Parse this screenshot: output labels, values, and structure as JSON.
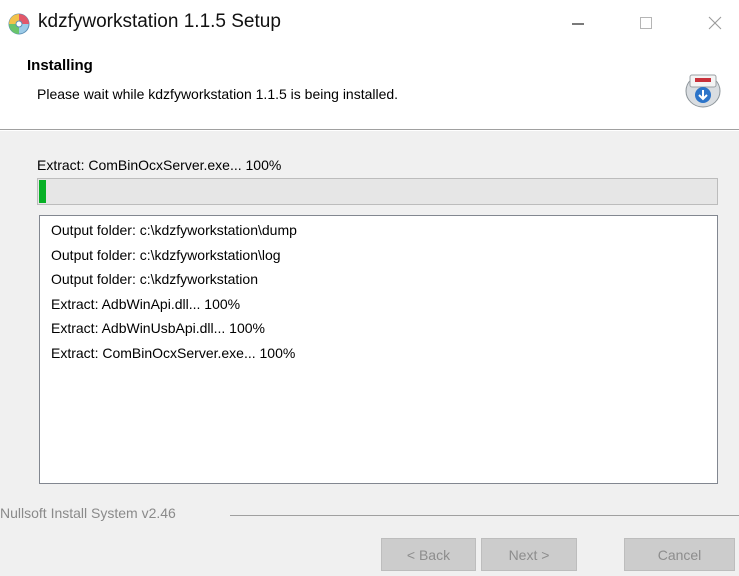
{
  "window": {
    "title": "kdzfyworkstation 1.1.5 Setup",
    "icon": "installer-disc-icon"
  },
  "header": {
    "title": "Installing",
    "subtitle": "Please wait while kdzfyworkstation 1.1.5 is being installed.",
    "icon": "installer-box-icon"
  },
  "status": {
    "text": "Extract: ComBinOcxServer.exe... 100%",
    "progress_percent": 1
  },
  "log": {
    "items": [
      "Output folder: c:\\kdzfyworkstation\\dump",
      "Output folder: c:\\kdzfyworkstation\\log",
      "Output folder: c:\\kdzfyworkstation",
      "Extract: AdbWinApi.dll... 100%",
      "Extract: AdbWinUsbApi.dll... 100%",
      "Extract: ComBinOcxServer.exe... 100%"
    ]
  },
  "footer": {
    "brand": "Nullsoft Install System v2.46",
    "back_label": "< Back",
    "next_label": "Next >",
    "cancel_label": "Cancel"
  },
  "colors": {
    "progress_fill": "#06b025",
    "disabled_button": "#cccccc"
  }
}
